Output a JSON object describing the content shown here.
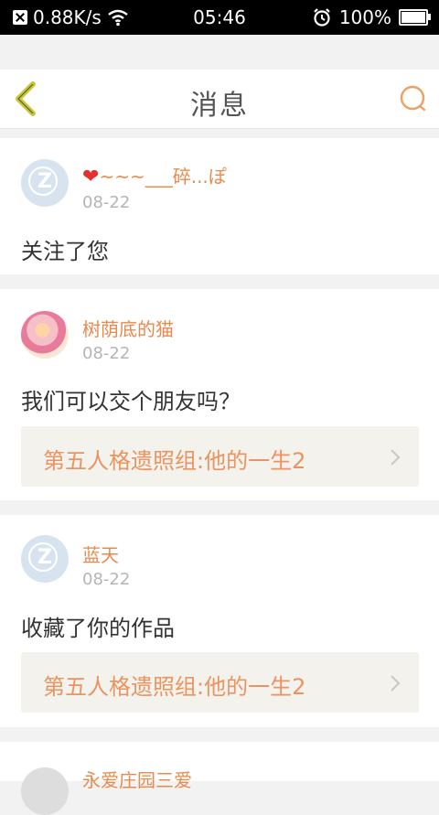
{
  "status_bar": {
    "speed": "0.88K/s",
    "time": "05:46",
    "battery": "100%"
  },
  "header": {
    "title": "消息"
  },
  "notifications": [
    {
      "user": "~~~___碎...ぽ",
      "date": "08-22",
      "message": "关注了您"
    },
    {
      "user": "树荫底的猫",
      "date": "08-22",
      "message": "我们可以交个朋友吗？",
      "link": "第五人格遗照组:他的一生2"
    },
    {
      "user": "蓝天",
      "date": "08-22",
      "message": "收藏了你的作品",
      "link": "第五人格遗照组:他的一生2"
    },
    {
      "user": "永爱庄园三爱"
    }
  ],
  "colors": {
    "accent": "#e98a4d",
    "title": "#555555",
    "back_arrow": "#c8c83a"
  }
}
